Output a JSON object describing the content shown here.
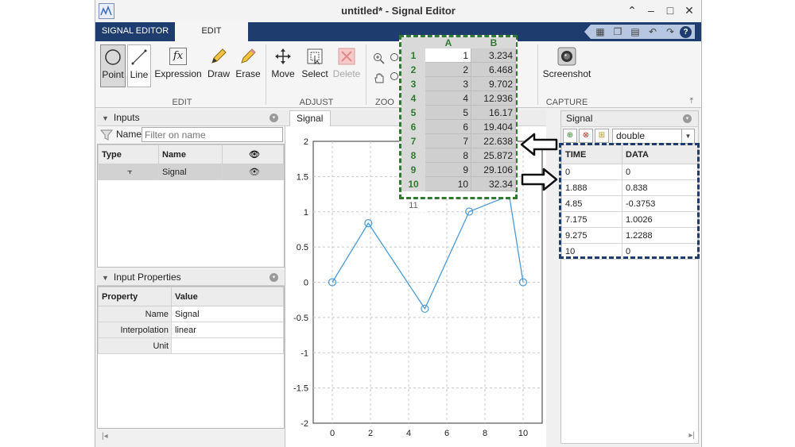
{
  "window": {
    "title": "untitled* - Signal Editor"
  },
  "tabs": {
    "signal_editor": "SIGNAL EDITOR",
    "edit": "EDIT"
  },
  "ribbon": {
    "point": "Point",
    "line": "Line",
    "expression": "Expression",
    "draw": "Draw",
    "erase": "Erase",
    "move": "Move",
    "select": "Select",
    "delete": "Delete",
    "screenshot": "Screenshot",
    "fx": "fx",
    "groups": {
      "edit": "EDIT",
      "adjust": "ADJUST",
      "zoom": "ZOO",
      "capture": "CAPTURE"
    }
  },
  "inputs_panel": {
    "title": "Inputs",
    "filter_label": "Name",
    "filter_placeholder": "Filter on name",
    "columns": [
      "Type",
      "Name"
    ],
    "rows": [
      {
        "name": "Signal"
      }
    ]
  },
  "properties_panel": {
    "title": "Input Properties",
    "columns": [
      "Property",
      "Value"
    ],
    "rows": [
      {
        "property": "Name",
        "value": "Signal"
      },
      {
        "property": "Interpolation",
        "value": "linear"
      },
      {
        "property": "Unit",
        "value": ""
      }
    ]
  },
  "plot": {
    "tab": "Signal",
    "tab_close": "×",
    "y_ticks": [
      "2",
      "1.5",
      "1",
      "0.5",
      "0",
      "-0.5",
      "-1",
      "-1.5",
      "-2"
    ],
    "x_ticks": [
      "0",
      "2",
      "4",
      "6",
      "8",
      "10"
    ]
  },
  "chart_data": {
    "type": "line",
    "x": [
      0,
      1.888,
      4.85,
      7.175,
      9.275,
      10
    ],
    "series": [
      {
        "values": [
          0,
          0.838,
          -0.3753,
          1.0026,
          1.2288,
          0
        ]
      }
    ],
    "ylim": [
      -2,
      2
    ],
    "xlim": [
      -1,
      11
    ],
    "grid": true,
    "color": "#4d9bd6"
  },
  "signal_panel": {
    "title": "Signal",
    "datatype": "double",
    "columns": [
      "TIME",
      "DATA"
    ],
    "rows": [
      {
        "time": "0",
        "data": "0"
      },
      {
        "time": "1.888",
        "data": "0.838"
      },
      {
        "time": "4.85",
        "data": "-0.3753"
      },
      {
        "time": "7.175",
        "data": "1.0026"
      },
      {
        "time": "9.275",
        "data": "1.2288"
      },
      {
        "time": "10",
        "data": "0"
      }
    ]
  },
  "spreadsheet": {
    "columns": [
      "A",
      "B"
    ],
    "row_numbers": [
      "1",
      "2",
      "3",
      "4",
      "5",
      "6",
      "7",
      "8",
      "9",
      "10"
    ],
    "trailing_row": "11",
    "col_a": [
      "1",
      "2",
      "3",
      "4",
      "5",
      "6",
      "7",
      "8",
      "9",
      "10"
    ],
    "col_b": [
      "3.234",
      "6.468",
      "9.702",
      "12.936",
      "16.17",
      "19.404",
      "22.638",
      "25.872",
      "29.106",
      "32.34"
    ]
  },
  "colors": {
    "accent": "#1e3d6e",
    "sheet_green": "#2f7a2f",
    "plot_line": "#4d9bd6"
  }
}
